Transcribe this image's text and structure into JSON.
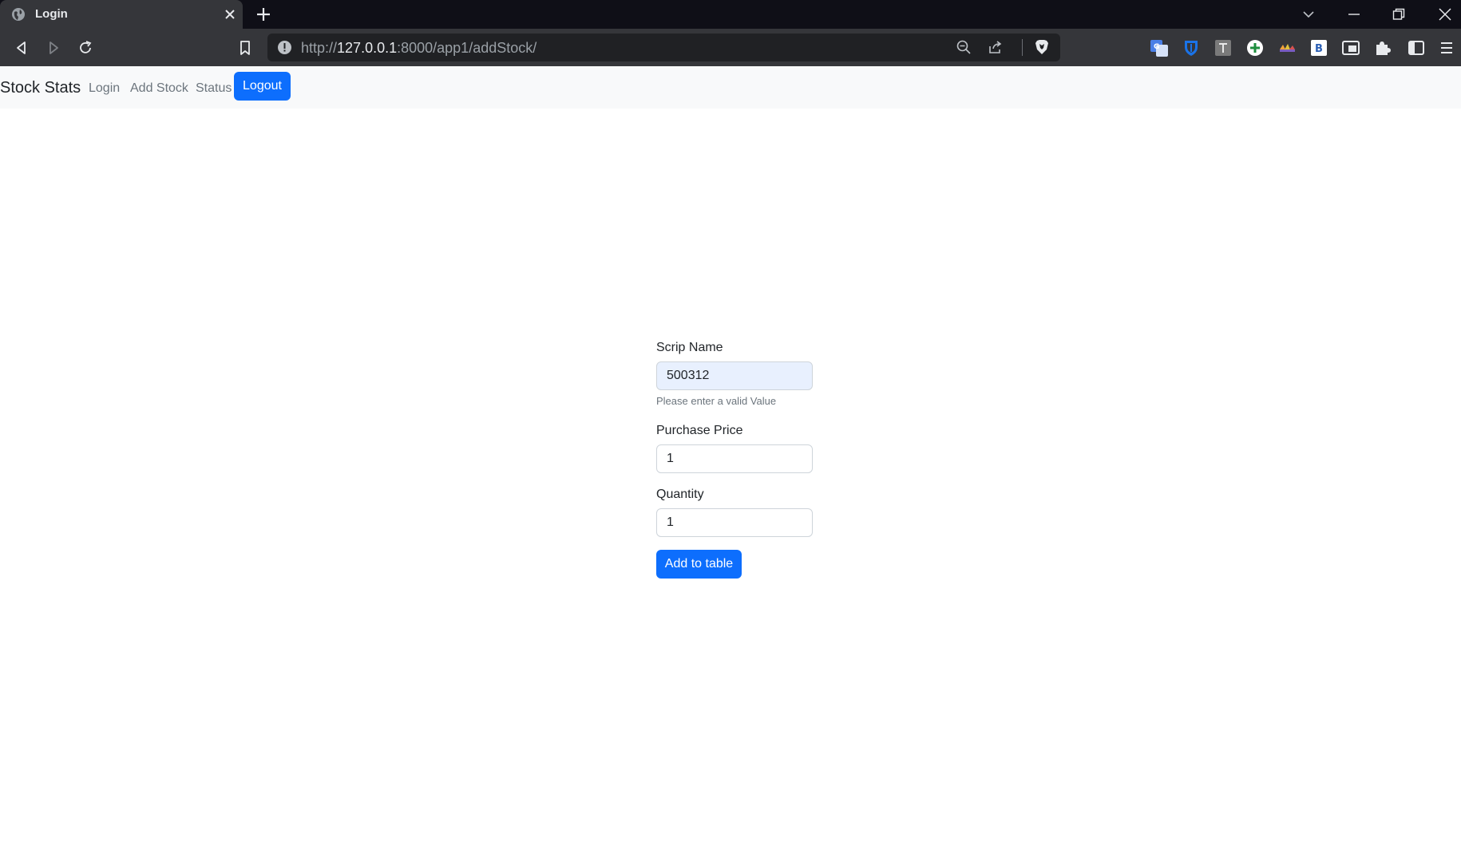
{
  "browser": {
    "tab": {
      "title": "Login"
    },
    "url": {
      "scheme": "http://",
      "host": "127.0.0.1",
      "rest": ":8000/app1/addStock/"
    },
    "extensions": [
      "translate-extension-icon",
      "shield-extension-icon",
      "t-extension-icon",
      "plus-extension-icon",
      "colorful-extension-icon",
      "b-extension-icon",
      "window-extension-icon",
      "puzzle-icon",
      "sidebar-icon",
      "menu-icon"
    ]
  },
  "navbar": {
    "brand": "Stock Stats",
    "links": [
      {
        "label": "Login"
      },
      {
        "label": "Add Stock"
      },
      {
        "label": "Status"
      }
    ],
    "logout_label": "Logout",
    "logout_color": "#0d6efd"
  },
  "form": {
    "scrip_name": {
      "label": "Scrip Name",
      "value": "500312",
      "help": "Please enter a valid Value"
    },
    "purchase_price": {
      "label": "Purchase Price",
      "value": "1"
    },
    "quantity": {
      "label": "Quantity",
      "value": "1"
    },
    "submit_label": "Add to table"
  }
}
